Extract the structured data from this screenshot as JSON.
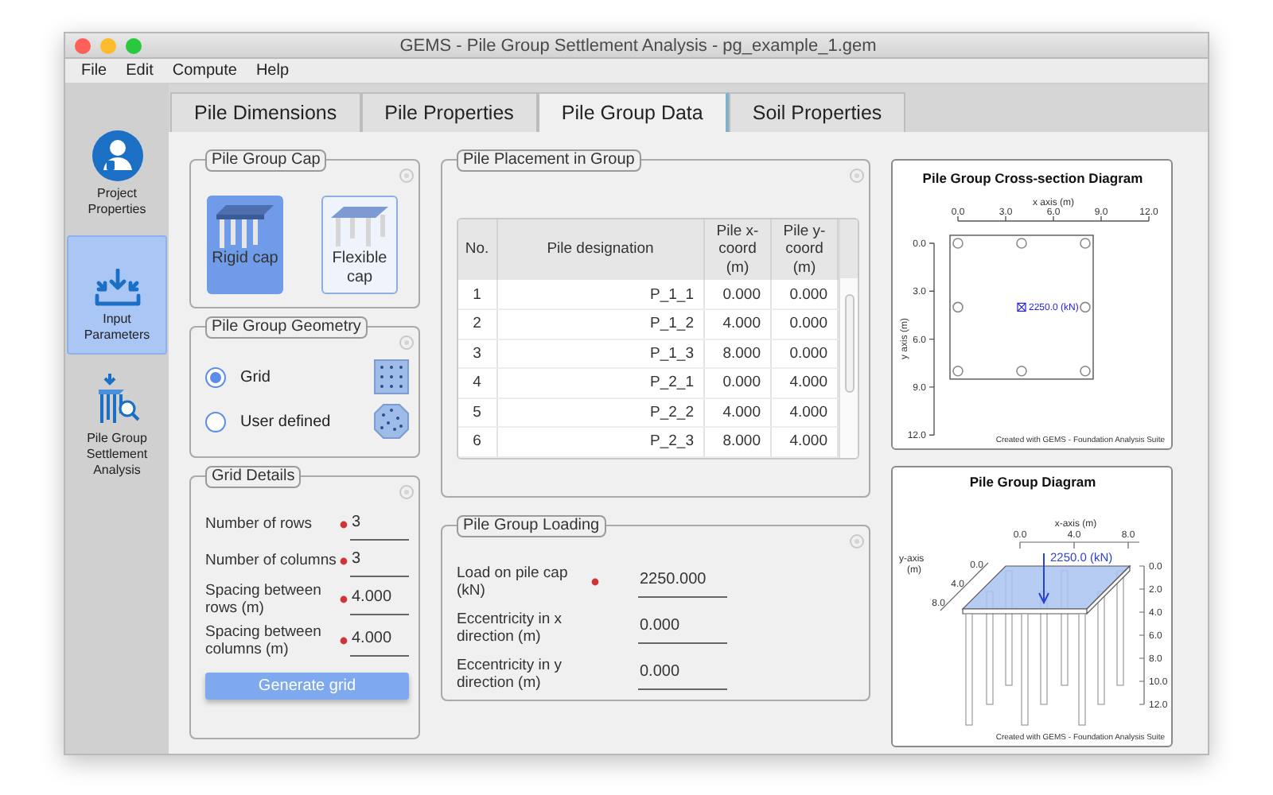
{
  "window": {
    "title": "GEMS - Pile Group Settlement Analysis - pg_example_1.gem"
  },
  "menu": [
    "File",
    "Edit",
    "Compute",
    "Help"
  ],
  "sidebar": {
    "items": [
      {
        "label": "Project Properties",
        "kind": "person",
        "selected": false
      },
      {
        "label": "Input Parameters",
        "kind": "input",
        "selected": true
      },
      {
        "label": "Pile Group Settlement Analysis",
        "kind": "analysis",
        "selected": false
      }
    ]
  },
  "tabs": [
    {
      "label": "Pile Dimensions",
      "selected": false
    },
    {
      "label": "Pile Properties",
      "selected": false
    },
    {
      "label": "Pile Group Data",
      "selected": true
    },
    {
      "label": "Soil Properties",
      "selected": false
    }
  ],
  "cap": {
    "title": "Pile Group Cap",
    "options": [
      {
        "label": "Rigid cap",
        "kind": "rigid",
        "selected": true
      },
      {
        "label": "Flexible cap",
        "kind": "flexible",
        "selected": false
      }
    ]
  },
  "geometry": {
    "title": "Pile Group Geometry",
    "options": [
      {
        "label": "Grid",
        "kind": "grid",
        "selected": true
      },
      {
        "label": "User defined",
        "kind": "scatter",
        "selected": false
      }
    ]
  },
  "grid_details": {
    "title": "Grid Details",
    "fields": [
      {
        "label": "Number of rows",
        "required": true,
        "value": "3"
      },
      {
        "label": "Number of columns",
        "required": true,
        "value": "3"
      },
      {
        "label": "Spacing between rows (m)",
        "required": true,
        "value": "4.000"
      },
      {
        "label": "Spacing between columns (m)",
        "required": true,
        "value": "4.000"
      }
    ],
    "button": "Generate grid"
  },
  "placement": {
    "title": "Pile Placement in Group",
    "table": {
      "columns": [
        "No.",
        "Pile designation",
        "Pile x-coord (m)",
        "Pile y-coord (m)"
      ],
      "rows": [
        [
          "1",
          "P_1_1",
          "0.000",
          "0.000"
        ],
        [
          "2",
          "P_1_2",
          "4.000",
          "0.000"
        ],
        [
          "3",
          "P_1_3",
          "8.000",
          "0.000"
        ],
        [
          "4",
          "P_2_1",
          "0.000",
          "4.000"
        ],
        [
          "5",
          "P_2_2",
          "4.000",
          "4.000"
        ],
        [
          "6",
          "P_2_3",
          "8.000",
          "4.000"
        ]
      ]
    }
  },
  "loading": {
    "title": "Pile Group Loading",
    "fields": [
      {
        "label": "Load on pile cap (kN)",
        "required": true,
        "value": "2250.000"
      },
      {
        "label": "Eccentricity in x direction (m)",
        "required": false,
        "value": "0.000"
      },
      {
        "label": "Eccentricity in y direction (m)",
        "required": false,
        "value": "0.000"
      }
    ]
  },
  "cross_section": {
    "chart_data": {
      "type": "scatter",
      "title": "Pile Group Cross-section Diagram",
      "xlabel": "x axis (m)",
      "ylabel": "y axis (m)",
      "x": [
        0,
        4,
        8,
        0,
        8,
        0,
        4,
        8
      ],
      "series": [
        {
          "color": "#8a8a8a",
          "values": [
            0,
            0,
            0,
            4,
            4,
            8,
            8,
            8
          ]
        }
      ],
      "xlim": [
        0,
        12
      ],
      "ylim": [
        12,
        0
      ],
      "xticks": [
        {
          "value": 0,
          "label": "0.0"
        },
        {
          "value": 3,
          "label": "3.0"
        },
        {
          "value": 6,
          "label": "6.0"
        },
        {
          "value": 9,
          "label": "9.0"
        },
        {
          "value": 12,
          "label": "12.0"
        }
      ],
      "yticks": [
        {
          "value": 0,
          "label": "0.0"
        },
        {
          "value": 3,
          "label": "3.0"
        },
        {
          "value": 6,
          "label": "6.0"
        },
        {
          "value": 9,
          "label": "9.0"
        },
        {
          "value": 12,
          "label": "12.0"
        }
      ],
      "annotations": [
        {
          "x": 4,
          "y": 4,
          "text": "2250.0 (kN)"
        }
      ]
    },
    "credit": "Created with GEMS - Foundation Analysis Suite"
  },
  "pile_diagram": {
    "title": "Pile Group Diagram",
    "x_axis": {
      "label": "x-axis (m)",
      "ticks": [
        "0.0",
        "4.0",
        "8.0"
      ]
    },
    "y_axis": {
      "label": "y-axis",
      "unit": "(m)",
      "ticks": [
        "0.0",
        "4.0",
        "8.0"
      ]
    },
    "depth_axis": {
      "ticks": [
        "0.0",
        "2.0",
        "4.0",
        "6.0",
        "8.0",
        "10.0",
        "12.0"
      ]
    },
    "load": "2250.0 (kN)",
    "credit": "Created with GEMS - Foundation Analysis Suite"
  }
}
